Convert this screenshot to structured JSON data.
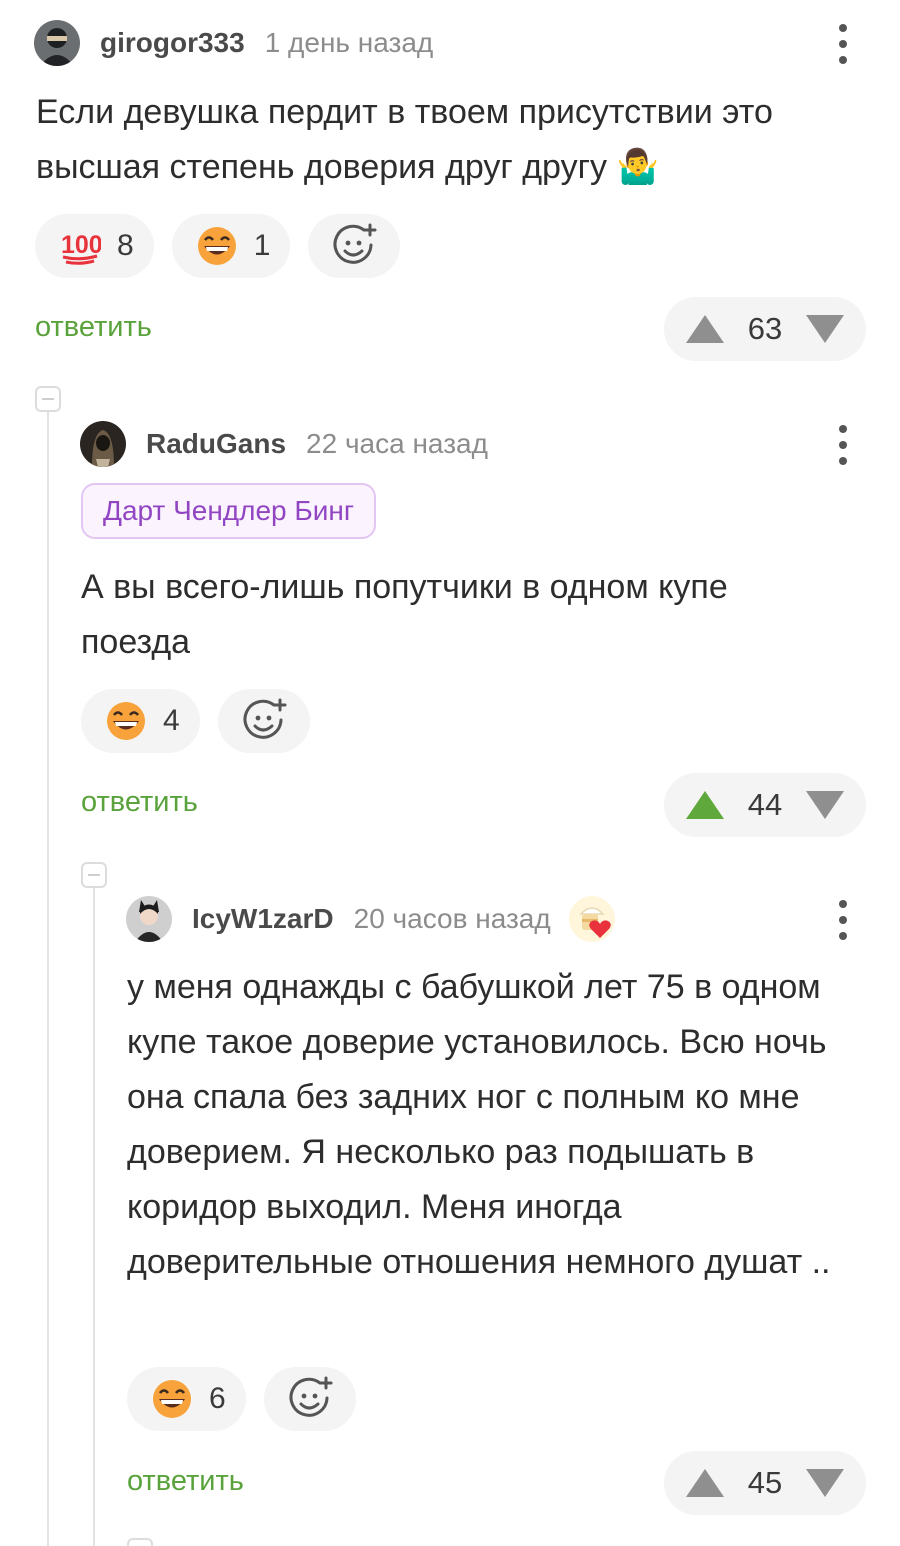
{
  "comments": [
    {
      "username": "girogor333",
      "time": "1 день назад",
      "text": "Если девушка пердит в твоем присутствии это высшая степень доверия друг другу",
      "text_emoji": "🤷‍♂️",
      "reactions": [
        {
          "icon": "hundred-points-icon",
          "count": "8"
        },
        {
          "icon": "grinning-face-icon",
          "count": "1"
        }
      ],
      "reply_label": "ответить",
      "score": "63",
      "upvoted": false
    },
    {
      "username": "RaduGans",
      "time": "22 часа назад",
      "tag": "Дарт Чендлер Бинг",
      "text": "А вы всего-лишь попутчики в одном купе поезда",
      "reactions": [
        {
          "icon": "grinning-face-icon",
          "count": "4"
        }
      ],
      "reply_label": "ответить",
      "score": "44",
      "upvoted": true,
      "accent_color": "#5fa83b"
    },
    {
      "username": "IcyW1zarD",
      "time": "20 часов назад",
      "badge_icon": "cake-heart-badge-icon",
      "text": "у меня однажды с бабушкой лет 75 в одном купе такое доверие установилось. Всю ночь она спала без задних ног с полным ко мне доверием. Я несколько раз подышать в коридор выходил. Меня иногда доверительные отношения немного душат ..",
      "reactions": [
        {
          "icon": "grinning-face-icon",
          "count": "6"
        }
      ],
      "reply_label": "ответить",
      "score": "45",
      "upvoted": false
    }
  ],
  "colors": {
    "reply": "#5aa33c",
    "tag_text": "#9145c2",
    "pill_bg": "#f4f4f4"
  }
}
